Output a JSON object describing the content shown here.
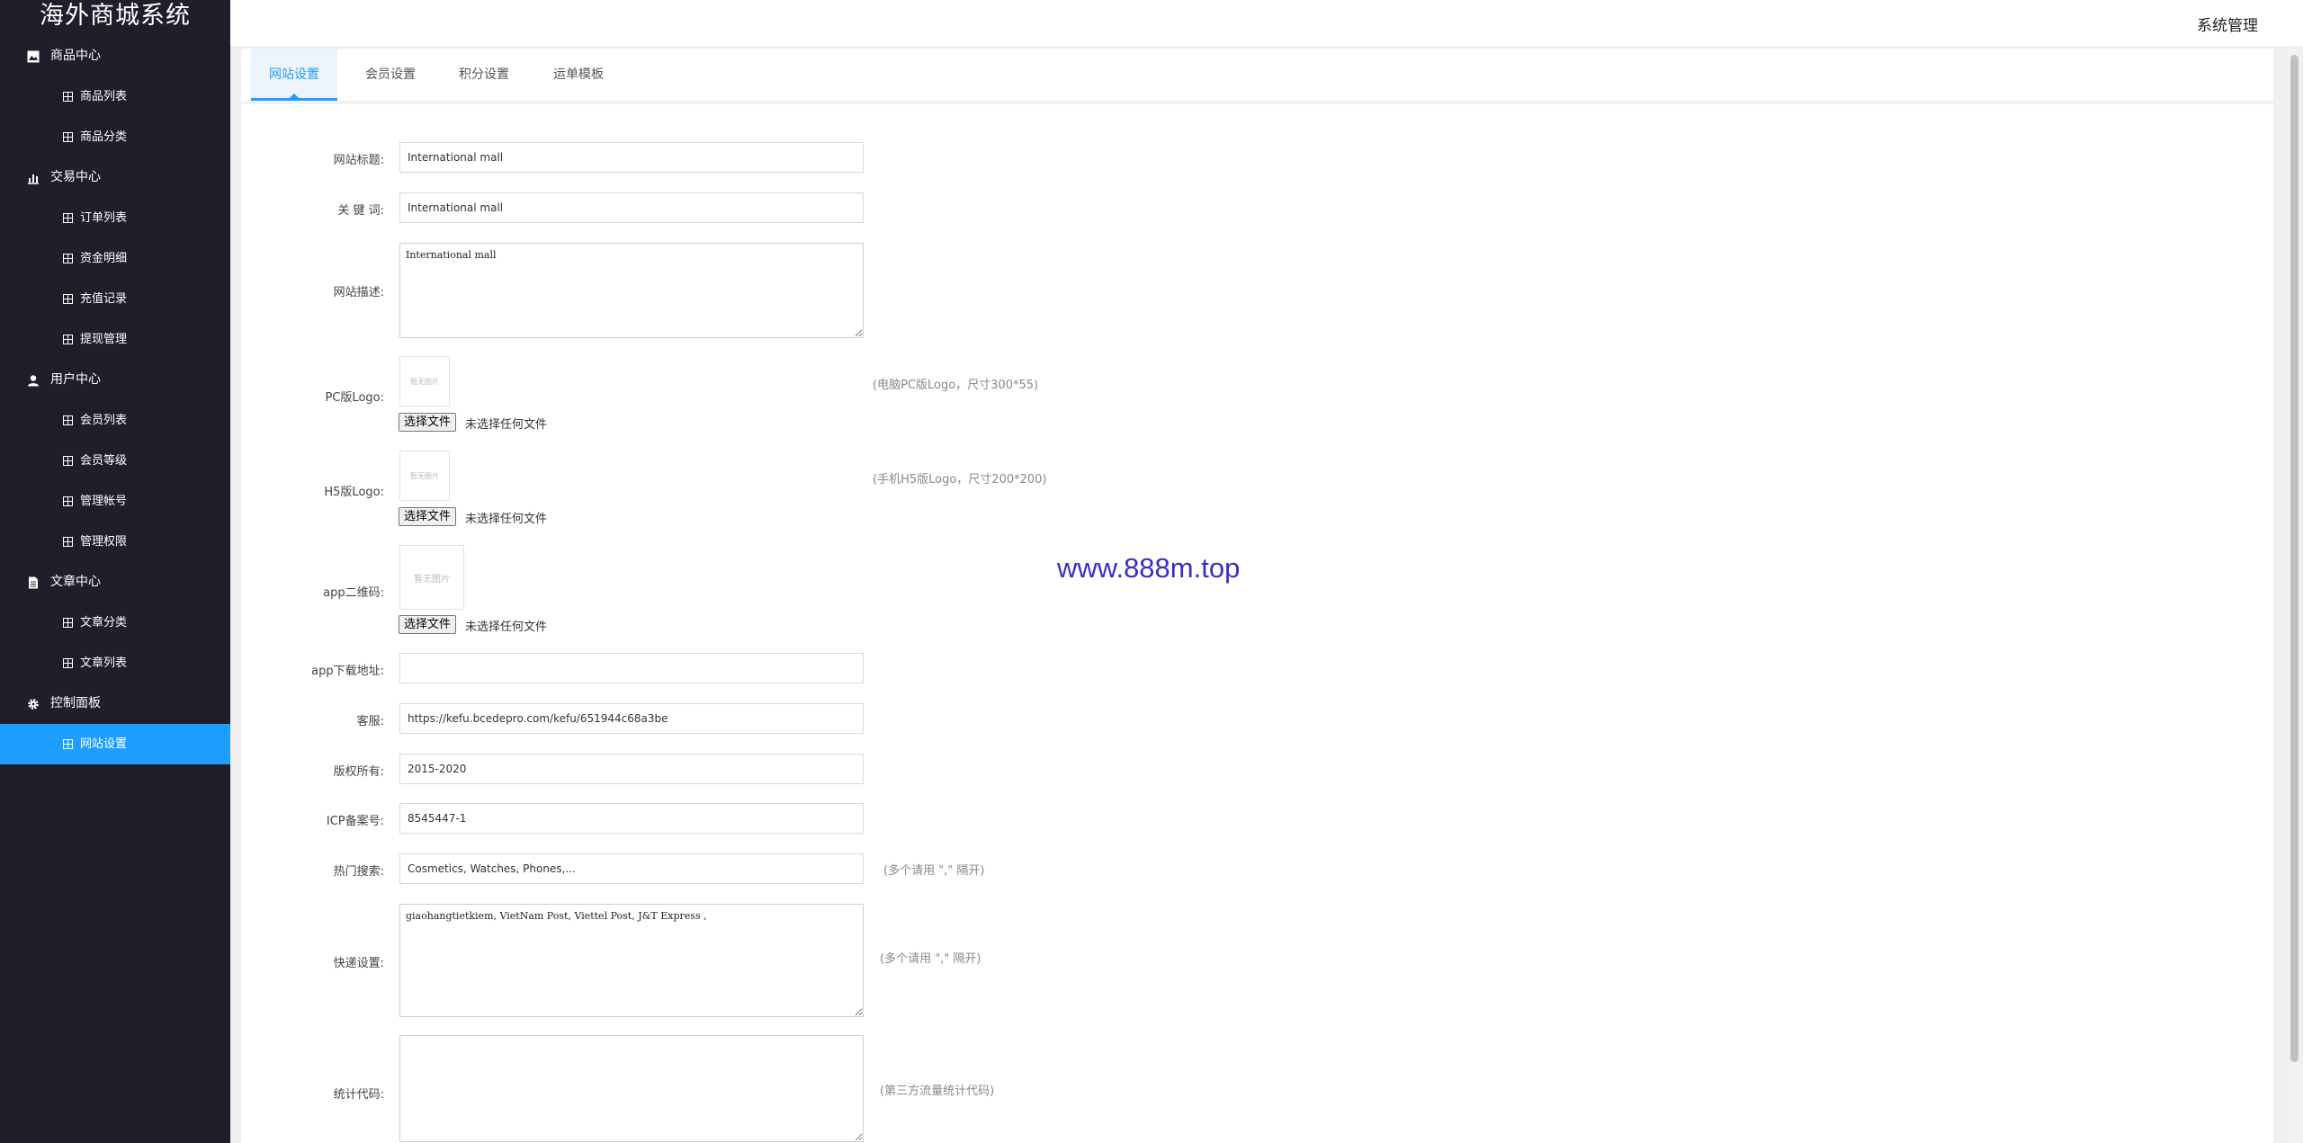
{
  "app": {
    "title": "海外商城系统",
    "header_right": "系统管理"
  },
  "sidebar": {
    "groups": [
      {
        "label": "商品中心",
        "icon": "picture-icon",
        "items": [
          {
            "label": "商品列表"
          },
          {
            "label": "商品分类"
          }
        ]
      },
      {
        "label": "交易中心",
        "icon": "chart-icon",
        "items": [
          {
            "label": "订单列表"
          },
          {
            "label": "资金明细"
          },
          {
            "label": "充值记录"
          },
          {
            "label": "提现管理"
          }
        ]
      },
      {
        "label": "用户中心",
        "icon": "user-icon",
        "items": [
          {
            "label": "会员列表"
          },
          {
            "label": "会员等级"
          },
          {
            "label": "管理帐号"
          },
          {
            "label": "管理权限"
          }
        ]
      },
      {
        "label": "文章中心",
        "icon": "document-icon",
        "items": [
          {
            "label": "文章分类"
          },
          {
            "label": "文章列表"
          }
        ]
      },
      {
        "label": "控制面板",
        "icon": "gear-icon",
        "items": [
          {
            "label": "网站设置",
            "active": true
          }
        ]
      }
    ]
  },
  "tabs": [
    {
      "label": "网站设置",
      "active": true
    },
    {
      "label": "会员设置"
    },
    {
      "label": "积分设置"
    },
    {
      "label": "运单模板"
    }
  ],
  "form": {
    "site_title": {
      "label": "网站标题:",
      "value": "International mall"
    },
    "keywords": {
      "label": "关 键 词:",
      "value": "International mall"
    },
    "description": {
      "label": "网站描述:",
      "value": "International mall"
    },
    "pc_logo": {
      "label": "PC版Logo:",
      "hint": "(电脑PC版Logo，尺寸300*55)",
      "placeholder": "暂无图片",
      "button": "选择文件",
      "file_status": "未选择任何文件"
    },
    "h5_logo": {
      "label": "H5版Logo:",
      "hint": "(手机H5版Logo，尺寸200*200)",
      "placeholder": "暂无图片",
      "button": "选择文件",
      "file_status": "未选择任何文件"
    },
    "app_qr": {
      "label": "app二维码:",
      "placeholder": "暂无图片",
      "button": "选择文件",
      "file_status": "未选择任何文件"
    },
    "app_download": {
      "label": "app下载地址:",
      "value": ""
    },
    "customer_service": {
      "label": "客服:",
      "value": "https://kefu.bcedepro.com/kefu/651944c68a3be"
    },
    "copyright": {
      "label": "版权所有:",
      "value": "2015-2020"
    },
    "icp": {
      "label": "ICP备案号:",
      "value": "8545447-1"
    },
    "hot_search": {
      "label": "热门搜索:",
      "value": "Cosmetics, Watches, Phones,...",
      "hint": "(多个请用 \",\" 隔开)"
    },
    "express": {
      "label": "快递设置:",
      "value": "giaohangtietkiem, VietNam Post, Viettel Post, J&T Express ,",
      "hint": "(多个请用 \",\" 隔开)"
    },
    "stats_code": {
      "label": "统计代码:",
      "value": "",
      "hint": "(第三方流量统计代码)"
    }
  },
  "watermark": "www.888m.top"
}
